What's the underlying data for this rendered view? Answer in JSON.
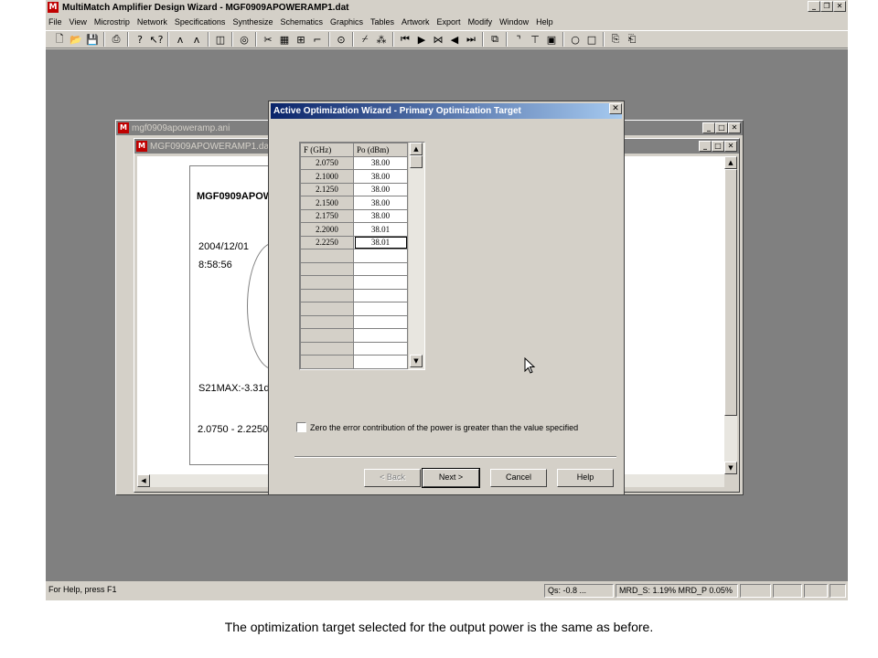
{
  "app": {
    "title": "MultiMatch Amplifier Design Wizard - MGF0909APOWERAMP1.dat",
    "logo": "M",
    "menu": [
      "File",
      "View",
      "Microstrip",
      "Network",
      "Specifications",
      "Synthesize",
      "Schematics",
      "Graphics",
      "Tables",
      "Artwork",
      "Export",
      "Modify",
      "Window",
      "Help"
    ],
    "toolbar_icons": [
      "new-icon",
      "open-icon",
      "save-icon",
      "print-icon",
      "help-icon",
      "context-help-icon",
      "tool-a1-icon",
      "tool-a2-icon",
      "tool-d-icon",
      "tool-circle-icon",
      "tool-scissors-icon",
      "tool-grid-icon",
      "tool-tree-icon",
      "tool-steps-icon",
      "tool-target-icon",
      "tool-probe-icon",
      "tool-net-icon",
      "first-icon",
      "play-icon",
      "bowtie-icon",
      "prev-icon",
      "last-icon",
      "copy-icon",
      "tool-bend-icon",
      "tool-tee-icon",
      "tool-box-icon",
      "circle-icon",
      "square-icon",
      "export1-icon",
      "export2-icon"
    ],
    "status": {
      "help": "For Help, press F1",
      "qs": "Qs:   -0.8 ...",
      "mrd": "MRD_S:  1.19% MRD_P  0.05%"
    }
  },
  "window_back": {
    "title": "mgf0909apoweramp.ani"
  },
  "window_front": {
    "title": "MGF0909APOWERAMP1.dat",
    "doc_title": "MGF0909APOW",
    "date": "2004/12/01",
    "time": "8:58:56",
    "s21": "S21MAX:-3.31d",
    "range": "2.0750 - 2.2250"
  },
  "dialog": {
    "title": "Active Optimization Wizard - Primary Optimization Target",
    "close": "✕",
    "table": {
      "headers": [
        "F (GHz)",
        "Po (dBm)"
      ],
      "rows": [
        [
          "2.0750",
          "38.00"
        ],
        [
          "2.1000",
          "38.00"
        ],
        [
          "2.1250",
          "38.00"
        ],
        [
          "2.1500",
          "38.00"
        ],
        [
          "2.1750",
          "38.00"
        ],
        [
          "2.2000",
          "38.01"
        ],
        [
          "2.2250",
          "38.01"
        ],
        [
          "",
          ""
        ],
        [
          "",
          ""
        ],
        [
          "",
          ""
        ],
        [
          "",
          ""
        ],
        [
          "",
          ""
        ],
        [
          "",
          ""
        ],
        [
          "",
          ""
        ],
        [
          "",
          ""
        ],
        [
          "",
          ""
        ]
      ]
    },
    "checkbox_label": "Zero the error contribution of the power is greater than the value specified",
    "checkbox_checked": false,
    "buttons": {
      "back": "< Back",
      "next": "Next >",
      "cancel": "Cancel",
      "help": "Help"
    }
  },
  "caption": "The optimization target selected for the output power is the same as before."
}
